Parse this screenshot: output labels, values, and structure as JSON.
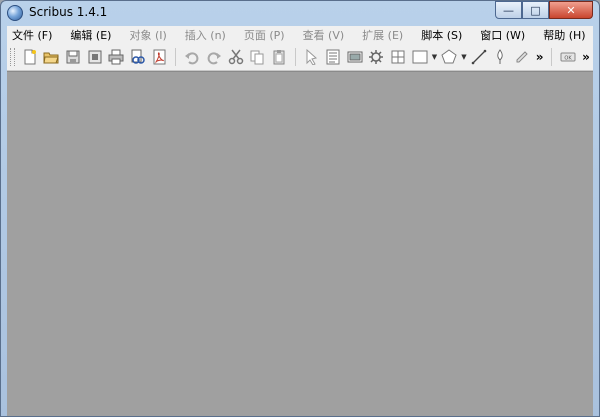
{
  "window": {
    "title": "Scribus 1.4.1"
  },
  "controls": {
    "minimize": "—",
    "maximize": "□",
    "close": "✕"
  },
  "menubar": [
    {
      "label": "文件 (F)",
      "enabled": true
    },
    {
      "label": "编辑 (E)",
      "enabled": true
    },
    {
      "label": "对象 (I)",
      "enabled": false
    },
    {
      "label": "插入 (n)",
      "enabled": false
    },
    {
      "label": "页面 (P)",
      "enabled": false
    },
    {
      "label": "查看 (V)",
      "enabled": false
    },
    {
      "label": "扩展 (E)",
      "enabled": false
    },
    {
      "label": "脚本 (S)",
      "enabled": true
    },
    {
      "label": "窗口 (W)",
      "enabled": true
    },
    {
      "label": "帮助 (H)",
      "enabled": true
    }
  ],
  "toolbar": {
    "overflow": "»",
    "overflow2": "»"
  }
}
